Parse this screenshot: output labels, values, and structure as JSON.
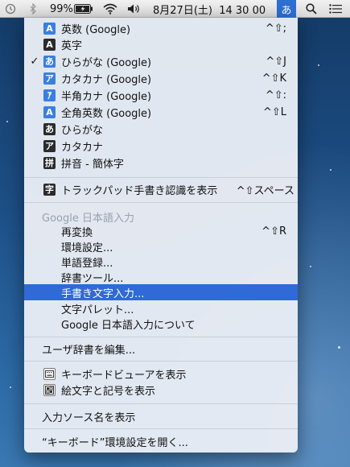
{
  "menubar": {
    "battery": "99%",
    "datetime": "8月27日(土)  14 30 00",
    "ime_indicator": "あ"
  },
  "menu": {
    "input_sources": [
      {
        "icon": "A",
        "icon_style": "blue",
        "label": "英数 (Google)",
        "shortcut": "^⇧;",
        "checked": false
      },
      {
        "icon": "A",
        "icon_style": "dark",
        "label": "英字",
        "shortcut": "",
        "checked": false
      },
      {
        "icon": "あ",
        "icon_style": "blue",
        "label": "ひらがな (Google)",
        "shortcut": "^⇧J",
        "checked": true
      },
      {
        "icon": "ア",
        "icon_style": "blue",
        "label": "カタカナ (Google)",
        "shortcut": "^⇧K",
        "checked": false
      },
      {
        "icon": "ｱ",
        "icon_style": "blue",
        "label": "半角カナ (Google)",
        "shortcut": "^⇧:",
        "checked": false
      },
      {
        "icon": "A",
        "icon_style": "blue",
        "label": "全角英数 (Google)",
        "shortcut": "^⇧L",
        "checked": false
      },
      {
        "icon": "あ",
        "icon_style": "dark",
        "label": "ひらがな",
        "shortcut": "",
        "checked": false
      },
      {
        "icon": "ア",
        "icon_style": "dark",
        "label": "カタカナ",
        "shortcut": "",
        "checked": false
      },
      {
        "icon": "拼",
        "icon_style": "dark",
        "label": "拼音 - 簡体字",
        "shortcut": "",
        "checked": false
      }
    ],
    "trackpad": {
      "icon": "字",
      "label": "トラックパッド手書き認識を表示",
      "shortcut": "^⇧スペース"
    },
    "google_header": "Google 日本語入力",
    "google_items": [
      {
        "label": "再変換",
        "shortcut": "^⇧R"
      },
      {
        "label": "環境設定...",
        "shortcut": ""
      },
      {
        "label": "単語登録...",
        "shortcut": ""
      },
      {
        "label": "辞書ツール...",
        "shortcut": ""
      },
      {
        "label": "手書き文字入力...",
        "shortcut": ""
      },
      {
        "label": "文字パレット...",
        "shortcut": ""
      },
      {
        "label": "Google 日本語入力について",
        "shortcut": ""
      }
    ],
    "user_dict": "ユーザ辞書を編集...",
    "keyboard_viewer": "キーボードビューアを表示",
    "emoji": "絵文字と記号を表示",
    "show_names": "入力ソース名を表示",
    "open_prefs": "“キーボード”環境設定を開く..."
  }
}
